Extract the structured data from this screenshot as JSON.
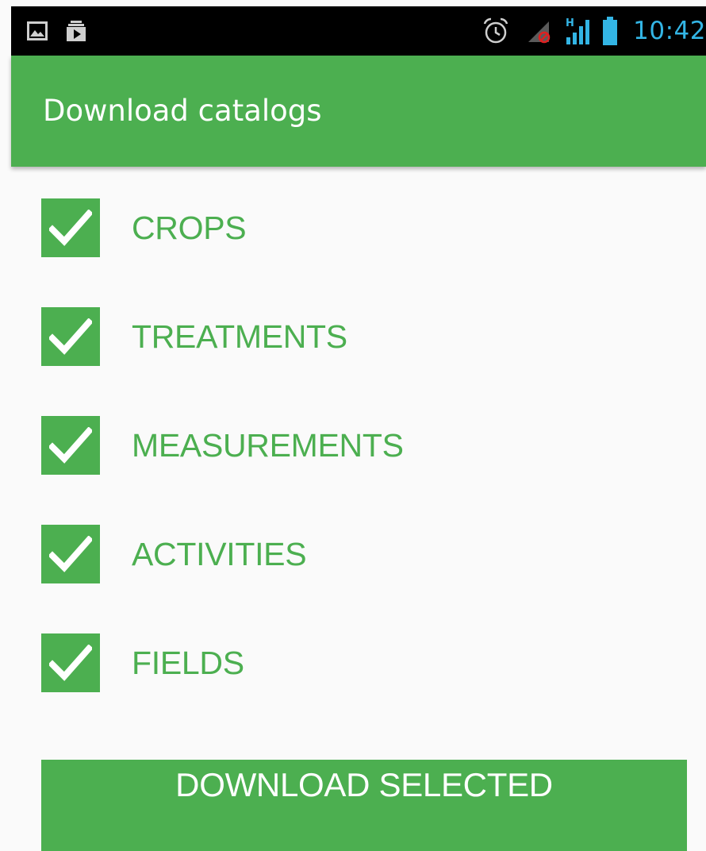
{
  "status_bar": {
    "time": "10:42",
    "left_icons": [
      "picture-icon",
      "media-play-icon"
    ],
    "right_icons": [
      "alarm-icon",
      "no-signal-icon",
      "hspa-signal-icon",
      "battery-icon"
    ],
    "clock_color": "#33b5e5"
  },
  "app_bar": {
    "title": "Download catalogs",
    "color": "#4caf50"
  },
  "catalogs": [
    {
      "label": "CROPS",
      "checked": true
    },
    {
      "label": "TREATMENTS",
      "checked": true
    },
    {
      "label": "MEASUREMENTS",
      "checked": true
    },
    {
      "label": "ACTIVITIES",
      "checked": true
    },
    {
      "label": "FIELDS",
      "checked": true
    }
  ],
  "download_button": {
    "label": "DOWNLOAD SELECTED"
  },
  "colors": {
    "accent": "#4caf50",
    "background": "#fafafa"
  }
}
